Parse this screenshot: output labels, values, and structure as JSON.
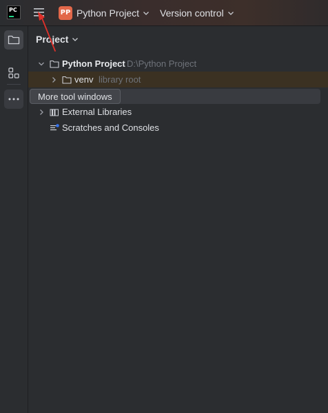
{
  "app": {
    "logo_text": "PC",
    "accent_color": "#21d789"
  },
  "titlebar": {
    "project_badge": "PP",
    "project_badge_color": "#e2684a",
    "project_name": "Python Project",
    "vcs_label": "Version control"
  },
  "stripe": {
    "items": [
      {
        "name": "project",
        "icon": "folder-icon",
        "active": true
      },
      {
        "name": "structure",
        "icon": "structure-icon"
      },
      {
        "name": "more",
        "icon": "more-icon"
      }
    ]
  },
  "panel": {
    "title": "Project",
    "tree": [
      {
        "label": "Python Project",
        "path": "D:\\Python Project",
        "expanded": true
      },
      {
        "label": "venv",
        "hint": "library root",
        "expanded": false
      },
      {
        "label": "External Libraries",
        "expanded": false
      },
      {
        "label": "Scratches and Consoles"
      }
    ]
  },
  "tooltip": {
    "text": "More tool windows"
  },
  "annotation": {
    "color": "#e0302a"
  }
}
